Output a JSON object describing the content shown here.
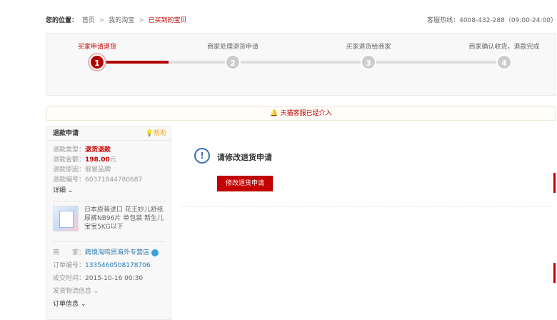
{
  "breadcrumb": {
    "label": "您的位置：",
    "items": [
      "首页",
      "我的淘宝",
      "已买到的宝贝"
    ],
    "separator": ">"
  },
  "hotline": "客服热线：4008-432-288（09:00-24:00）",
  "steps": [
    {
      "number": "1",
      "label": "买家申请退货",
      "active": true
    },
    {
      "number": "2",
      "label": "商家处理退货申请",
      "active": false
    },
    {
      "number": "3",
      "label": "买家退货给商家",
      "active": false
    },
    {
      "number": "4",
      "label": "商家确认收货，退款完成",
      "active": false
    }
  ],
  "notice": "天猫客服已经介入",
  "sidebar": {
    "title": "退款申请",
    "help": "帮助",
    "rows": [
      {
        "key": "退款类型：",
        "value": "退货退款"
      },
      {
        "key": "退款金额：",
        "value": "198.00",
        "unit": "元"
      },
      {
        "key": "退款原因：",
        "value": "假冒品牌"
      },
      {
        "key": "退款编号：",
        "value": "603718447806​87"
      }
    ],
    "detail_label": "详细",
    "product_title": "日本原装进口 花王妙儿舒纸尿裤NB96片 单包装 新生儿宝宝5KG以下",
    "shop_key": "商　　家：",
    "shop_name": "跨境淘鸣贸海外专营店",
    "order_key": "订单编号：",
    "order_no": "1335460508178706",
    "time_key": "成交时间：",
    "time": "2015-10-16 00:30",
    "shipping_label": "发货物流信息",
    "order_info_label": "订单信息"
  },
  "main": {
    "title": "请修改退货申请",
    "button": "修改退货申请"
  },
  "colors": {
    "accent": "#c40000",
    "link": "#2a7ab0",
    "warn": "#f5a623",
    "info": "#3b6db6"
  }
}
